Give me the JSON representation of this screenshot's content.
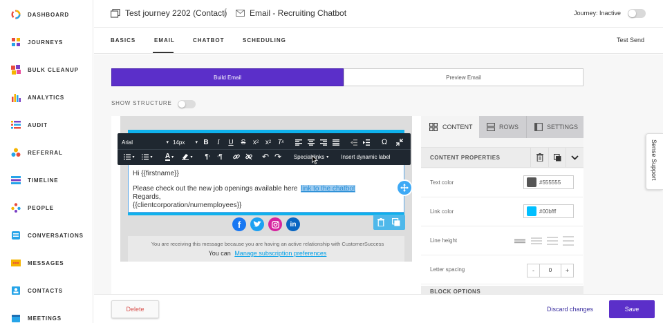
{
  "sidebar": {
    "items": [
      {
        "label": "DASHBOARD",
        "icon": "dashboard-icon"
      },
      {
        "label": "JOURNEYS",
        "icon": "journeys-icon"
      },
      {
        "label": "BULK CLEANUP",
        "icon": "bulk-cleanup-icon"
      },
      {
        "label": "ANALYTICS",
        "icon": "analytics-icon"
      },
      {
        "label": "AUDIT",
        "icon": "audit-icon"
      },
      {
        "label": "REFERRAL",
        "icon": "referral-icon"
      },
      {
        "label": "TIMELINE",
        "icon": "timeline-icon"
      },
      {
        "label": "PEOPLE",
        "icon": "people-icon"
      },
      {
        "label": "CONVERSATIONS",
        "icon": "conversations-icon"
      },
      {
        "label": "MESSAGES",
        "icon": "messages-icon"
      },
      {
        "label": "CONTACTS",
        "icon": "contacts-icon"
      },
      {
        "label": "MEETINGS",
        "icon": "meetings-icon"
      }
    ]
  },
  "header": {
    "journey_title": "Test journey 2202 (Contact)",
    "separator": "/",
    "email_title": "Email - Recruiting Chatbot",
    "status_label": "Journey: Inactive"
  },
  "tabs": {
    "items": [
      "BASICS",
      "EMAIL",
      "CHATBOT",
      "SCHEDULING"
    ],
    "active": "EMAIL",
    "test_send": "Test Send"
  },
  "builder": {
    "build_label": "Build Email",
    "preview_label": "Preview Email",
    "show_structure": "SHOW STRUCTURE"
  },
  "toolbar": {
    "font": "Arial",
    "size": "14px",
    "special_links": "Special links",
    "insert_label": "Insert dynamic label"
  },
  "email": {
    "greeting": "Hi {{firstname}}",
    "line1": "Please check out the new job openings available here",
    "link_text": "link to the chatbot",
    "regards": "Regards,",
    "merge_field": "{{clientcorporation/numemployees}}",
    "footer_text": "You are receiving this message because you are having an active relationship with CustomerSuccess",
    "you_can": "You can",
    "manage_link": "Manage subscription preferences"
  },
  "right_panel": {
    "tabs": [
      "CONTENT",
      "ROWS",
      "SETTINGS"
    ],
    "content_properties": "CONTENT PROPERTIES",
    "text_color_label": "Text color",
    "text_color_value": "#555555",
    "link_color_label": "Link color",
    "link_color_value": "#00bfff",
    "line_height_label": "Line height",
    "letter_spacing_label": "Letter spacing",
    "letter_spacing_minus": "-",
    "letter_spacing_value": "0",
    "letter_spacing_plus": "+",
    "block_options": "BLOCK OPTIONS"
  },
  "sense_support": "Sense Support",
  "footer": {
    "delete": "Delete",
    "discard": "Discard changes",
    "save": "Save"
  },
  "colors": {
    "accent": "#5b2fc9",
    "email_bar": "#0fb1ec",
    "toolbar": "#1f2730",
    "link_highlight": "#9ccbf0"
  }
}
